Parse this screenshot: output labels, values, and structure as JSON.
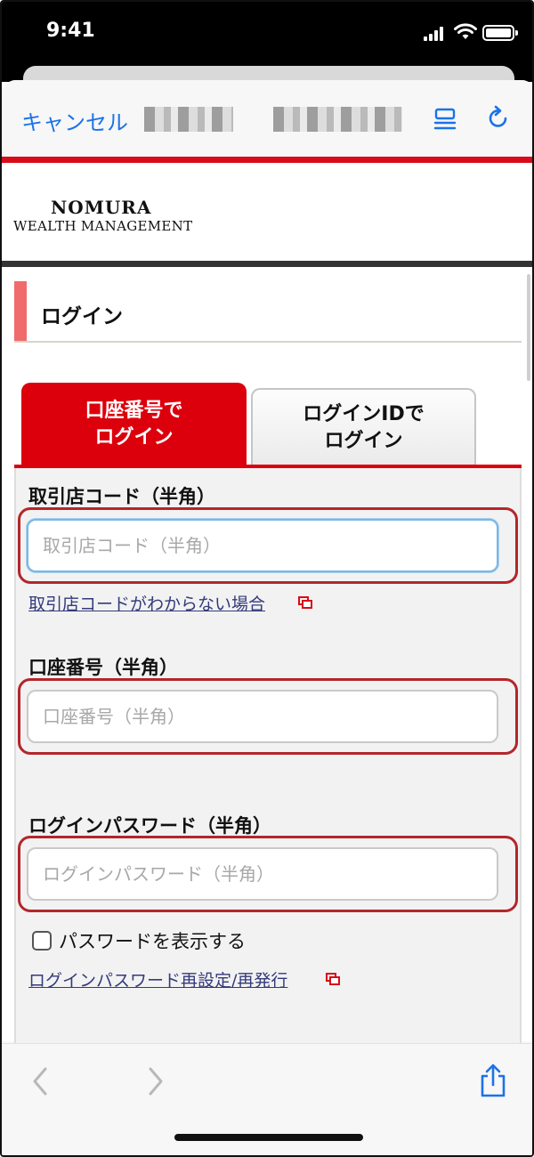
{
  "status_bar": {
    "time": "9:41"
  },
  "nav": {
    "cancel_label": "キャンセル"
  },
  "brand": {
    "logo_main": "NOMURA",
    "logo_sub": "WEALTH MANAGEMENT"
  },
  "section": {
    "title": "ログイン"
  },
  "tabs": [
    {
      "label": "口座番号で\nログイン",
      "active": true
    },
    {
      "label": "ログインIDで\nログイン",
      "active": false
    }
  ],
  "form": {
    "branch_code": {
      "label": "取引店コード（半角）",
      "placeholder": "取引店コード（半角）",
      "value": "",
      "help_link": "取引店コードがわからない場合"
    },
    "account_number": {
      "label": "口座番号（半角）",
      "placeholder": "口座番号（半角）",
      "value": ""
    },
    "password": {
      "label": "ログインパスワード（半角）",
      "placeholder": "ログインパスワード（半角）",
      "value": ""
    },
    "show_password_label": "パスワードを表示する",
    "reset_link": "ログインパスワード再設定/再発行"
  },
  "colors": {
    "brand_red": "#dc000c",
    "link_blue": "#1a73e8",
    "highlight_red": "#b3262b",
    "section_accent": "#f06b6b"
  },
  "icons": [
    "signal-icon",
    "wifi-icon",
    "battery-icon",
    "reader-icon",
    "reload-icon",
    "external-link-icon",
    "back-icon",
    "forward-icon",
    "share-icon"
  ]
}
